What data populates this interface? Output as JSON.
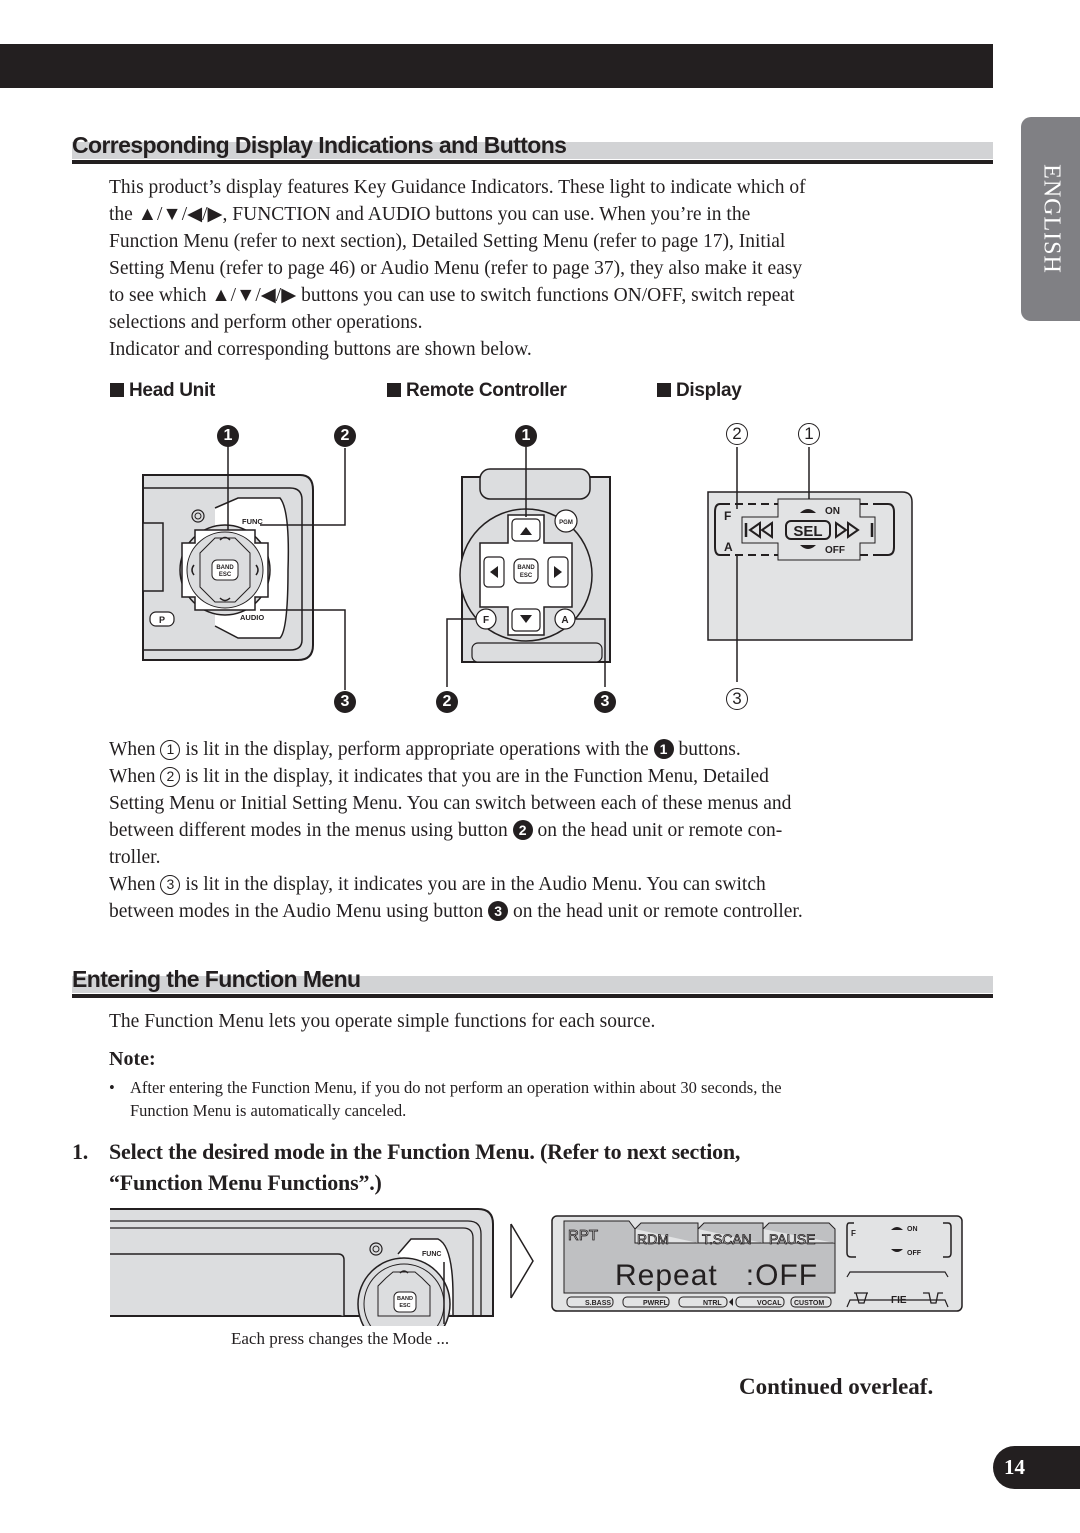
{
  "side_tab": {
    "label": "ENGLISH"
  },
  "section1": {
    "title": "Corresponding Display Indications and Buttons",
    "intro_lines": [
      "This product’s display features Key Guidance Indicators. These light to indicate which of",
      "the ▲/▼/◀/▶, FUNCTION and AUDIO buttons you can use. When you’re in the",
      "Function Menu (refer to next section), Detailed Setting Menu (refer to page 17), Initial",
      "Setting Menu (refer to page 46) or Audio Menu (refer to page 37), they also make it easy",
      "to see which ▲/▼/◀/▶ buttons you can use to switch functions ON/OFF, switch repeat",
      "selections and perform other operations.",
      "Indicator and corresponding buttons are shown below."
    ],
    "figure_labels": {
      "head_unit": "Head Unit",
      "remote": "Remote Controller",
      "display": "Display"
    },
    "callouts": {
      "filled_1": "1",
      "filled_2": "2",
      "filled_3": "3",
      "outline_1": "1",
      "outline_2": "2",
      "outline_3": "3"
    },
    "head_unit_buttons": {
      "func": "FUNC",
      "audio": "AUDIO",
      "band": "BAND",
      "esc": "ESC",
      "p": "P"
    },
    "remote_buttons": {
      "pgm": "PGM",
      "band": "BAND",
      "esc": "ESC",
      "f": "F",
      "a": "A"
    },
    "display_indicators": {
      "f": "F",
      "a": "A",
      "on": "ON",
      "off": "OFF",
      "sel": "SEL"
    },
    "explanation": {
      "line1_pre": "When ",
      "line1_mid": " is lit in the display, perform appropriate operations with the ",
      "line1_post": " buttons.",
      "line2_pre": "When ",
      "line2_post": " is lit in the display, it indicates that you are in the Function Menu, Detailed",
      "line3": "Setting Menu or Initial Setting Menu. You can switch between each of these menus and",
      "line4_pre": "between different modes in the menus using button ",
      "line4_post": " on the head unit or remote con-",
      "line5": "troller.",
      "line6_pre": "When ",
      "line6_post": " is lit in the display, it indicates you are in the Audio Menu. You can switch",
      "line7_pre": "between modes in the Audio Menu using button ",
      "line7_post": " on the head unit or remote controller."
    }
  },
  "section2": {
    "title": "Entering the Function Menu",
    "intro": "The Function Menu lets you operate simple functions for each source.",
    "note_title": "Note:",
    "note_bullet": "•",
    "note_lines": [
      "After entering the Function Menu, if you do not perform an operation within about 30 seconds, the",
      "Function Menu is automatically canceled."
    ],
    "step_number": "1.",
    "step_lines": [
      "Select the desired mode in the Function Menu. (Refer to next section,",
      "“Function Menu Functions”.)"
    ],
    "fig_func_label": "FUNC",
    "fig_band": "BAND",
    "fig_esc": "ESC",
    "caption": "Each press changes the Mode ...",
    "lcd": {
      "tabs": [
        "RPT",
        "RDM",
        "T.SCAN",
        "PAUSE"
      ],
      "active_tab": "RPT",
      "main_text": "Repeat   :OFF",
      "eq_presets": [
        "S.BASS",
        "PWRFL",
        "NTRL",
        "VOCAL",
        "CUSTOM"
      ],
      "selected_preset": "NTRL",
      "f_label": "F",
      "on_label": "ON",
      "off_label": "OFF",
      "fie_label": "FIE"
    }
  },
  "footer": {
    "continued": "Continued overleaf.",
    "page_number": "14"
  }
}
